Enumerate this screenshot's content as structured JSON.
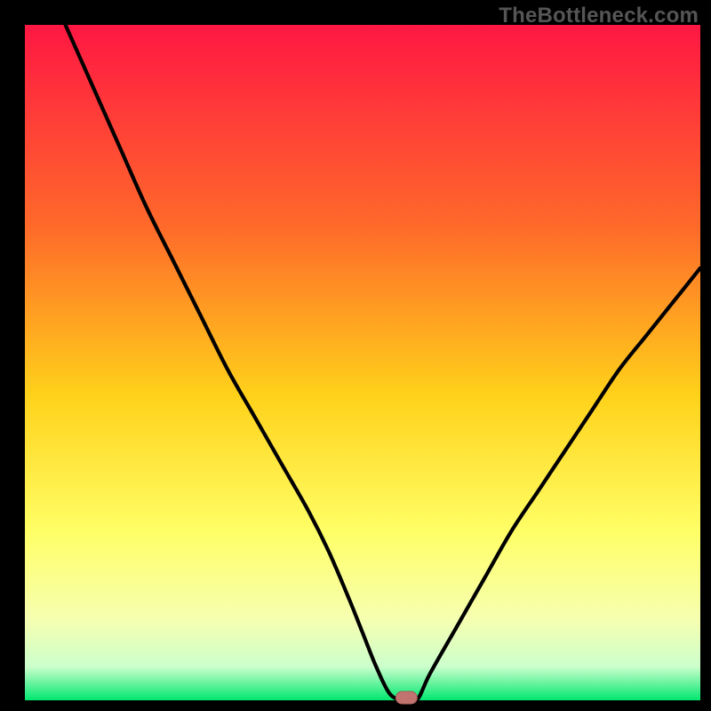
{
  "watermark": "TheBottleneck.com",
  "colors": {
    "frame": "#000000",
    "curve": "#000000",
    "marker_fill": "#c1736f",
    "marker_stroke": "#a45b57",
    "grad_top": "#ff1743",
    "grad_mid1": "#ff6a2a",
    "grad_mid2": "#ffd21a",
    "grad_mid3": "#ffff66",
    "grad_mid4": "#f6ffb0",
    "grad_mid5": "#ccffcc",
    "grad_bot": "#00e76f"
  },
  "chart_data": {
    "type": "line",
    "title": "",
    "xlabel": "",
    "ylabel": "",
    "xlim": [
      0,
      100
    ],
    "ylim": [
      0,
      100
    ],
    "x": [
      6,
      10,
      14,
      18,
      22,
      26,
      30,
      34,
      38,
      42,
      45,
      48,
      50,
      52,
      54,
      56,
      58,
      60,
      64,
      68,
      72,
      76,
      80,
      84,
      88,
      92,
      96,
      100
    ],
    "values": [
      100,
      91,
      82,
      73,
      65,
      57,
      49,
      42,
      35,
      28,
      22,
      15,
      10,
      5,
      1,
      0,
      0,
      4,
      11,
      18,
      25,
      31,
      37,
      43,
      49,
      54,
      59,
      64
    ],
    "marker": {
      "x": 56.5,
      "y": 0
    }
  }
}
